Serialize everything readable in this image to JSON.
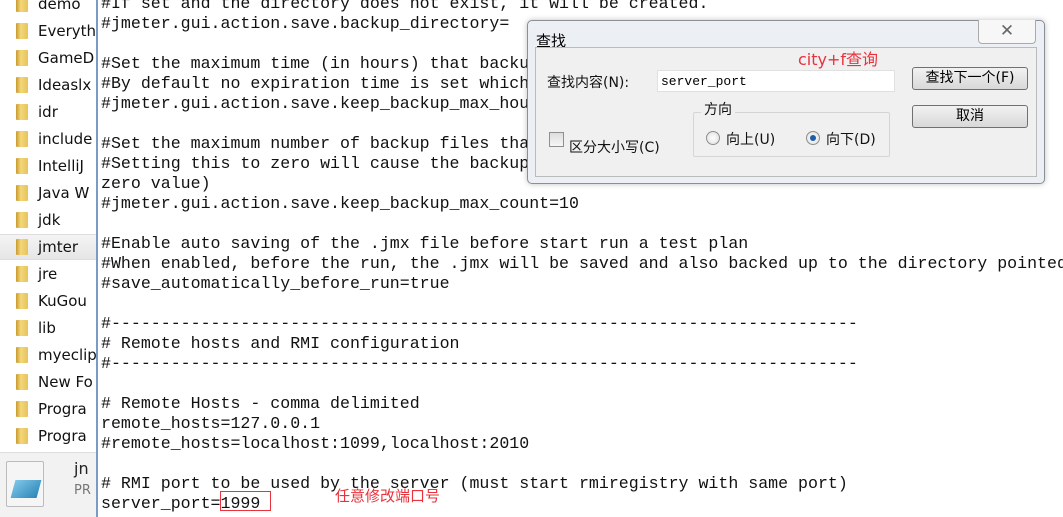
{
  "sidebar": {
    "folders": [
      "demo",
      "Everyth",
      "GameD",
      "Ideaslx",
      "idr",
      "include",
      "IntelliJ",
      "Java W",
      "jdk",
      "jmter",
      "jre",
      "KuGou",
      "lib",
      "myeclip",
      "New Fo",
      "Progra",
      "Progra"
    ],
    "selected": "jmter",
    "file": {
      "name": "jn",
      "type": "PR"
    }
  },
  "editor": {
    "lines": [
      "#If set and the directory does not exist, it will be created.",
      "#jmeter.gui.action.save.backup_directory=",
      "",
      "#Set the maximum time (in hours) that backu",
      "#By default no expiration time is set which",
      "#jmeter.gui.action.save.keep_backup_max_hou",
      "",
      "#Set the maximum number of backup files tha",
      "#Setting this to zero will cause the backup",
      "zero value)",
      "#jmeter.gui.action.save.keep_backup_max_count=10",
      "",
      "#Enable auto saving of the .jmx file before start run a test plan",
      "#When enabled, before the run, the .jmx will be saved and also backed up to the directory pointed",
      "#save_automatically_before_run=true",
      "",
      "#---------------------------------------------------------------------------",
      "# Remote hosts and RMI configuration",
      "#---------------------------------------------------------------------------",
      "",
      "# Remote Hosts - comma delimited",
      "remote_hosts=127.0.0.1",
      "#remote_hosts=localhost:1099,localhost:2010",
      "",
      "# RMI port to be used by the server (must start rmiregistry with same port)",
      "server_port=1999"
    ]
  },
  "dialog": {
    "title": "查找",
    "close_icon": "close-icon",
    "find_label": "查找内容(N):",
    "find_value": "server_port",
    "find_next": "查找下一个(F)",
    "cancel": "取消",
    "direction_label": "方向",
    "up": "向上(U)",
    "down": "向下(D)",
    "direction_selected": "down",
    "match_case": "区分大小写(C)",
    "match_case_checked": false
  },
  "annotations": {
    "shortcut_note": "city+f查询",
    "port_note": "任意修改端口号",
    "color": "#e8323c"
  }
}
